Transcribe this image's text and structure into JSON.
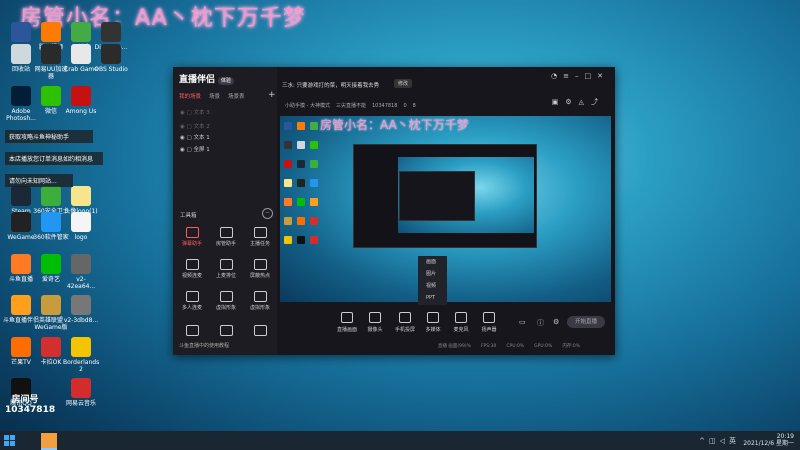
{
  "watermark": "房管小名：AA丶枕下万千梦",
  "watermark_preview": "房管小名：AA丶枕下万千梦",
  "desktop": {
    "icons": [
      {
        "label": "W",
        "color": "#2b579a"
      },
      {
        "label": "腾讯视频",
        "color": "#ff7a00"
      },
      {
        "label": "IYI迷你",
        "color": "#44aa44"
      },
      {
        "label": "DiceHelp...",
        "color": "#333"
      },
      {
        "label": "回收站",
        "color": "#cfd8dc"
      },
      {
        "label": "网易UU加速器",
        "color": "#2a2a2a"
      },
      {
        "label": "Crab Game",
        "color": "#e8e8e8"
      },
      {
        "label": "OBS Studio",
        "color": "#2b2b2b"
      },
      {
        "label": "Adobe Photosh...",
        "color": "#001e36"
      },
      {
        "label": "微信",
        "color": "#2dc100"
      },
      {
        "label": "Among Us",
        "color": "#c51111"
      },
      {
        "label": "Steam",
        "color": "#1b2838"
      },
      {
        "label": "360安全卫士",
        "color": "#3cae3c"
      },
      {
        "label": "头像logo(1)",
        "color": "#f6e58d"
      },
      {
        "label": "WeGame",
        "color": "#222"
      },
      {
        "label": "360软件管家",
        "color": "#2196f3"
      },
      {
        "label": "logo",
        "color": "#f5f5f5"
      },
      {
        "label": "斗鱼直播",
        "color": "#ff7a22"
      },
      {
        "label": "爱奇艺",
        "color": "#00be06"
      },
      {
        "label": "v2-42ea64...",
        "color": "#666"
      },
      {
        "label": "斗鱼直播伴侣",
        "color": "#ff9f1c"
      },
      {
        "label": "英雄联盟WeGame版",
        "color": "#c89b3c"
      },
      {
        "label": "v2-3dbd8...",
        "color": "#777"
      },
      {
        "label": "芒果TV",
        "color": "#ff6d00"
      },
      {
        "label": "卡拉OK",
        "color": "#d32f2f"
      },
      {
        "label": "Borderlands 2",
        "color": "#f2c500"
      },
      {
        "label": "腾讯QQ",
        "color": "#111"
      },
      {
        "label": "网易云音乐",
        "color": "#d42b2b"
      }
    ],
    "banner1": "获取攻略斗鱼神秘助手",
    "banner2": "本店播放您订单消息如约相消息",
    "banner3": "请勿向未知网站...",
    "room_label": "房间号",
    "room_id": "10347818"
  },
  "app": {
    "logo": "直播伴侣",
    "logo_badge": "体验",
    "scene_tabs": [
      {
        "label": "我的场景",
        "active": true
      },
      {
        "label": "场景",
        "active": false
      },
      {
        "label": "场景表",
        "active": false
      }
    ],
    "layers": [
      {
        "label": "文本 3",
        "dim": true
      },
      {
        "label": "文本 2",
        "dim": true
      },
      {
        "label": "文本 1",
        "dim": false
      },
      {
        "label": "全屏 1",
        "dim": false
      }
    ],
    "tools_title": "工具箱",
    "tools": [
      {
        "label": "弹幕助手",
        "red": true
      },
      {
        "label": "房管助手",
        "red": false
      },
      {
        "label": "主播任务",
        "red": false
      },
      {
        "label": "视频连麦",
        "red": false
      },
      {
        "label": "上麦排位",
        "red": false
      },
      {
        "label": "屏蔽热点",
        "red": false
      },
      {
        "label": "多人连麦",
        "red": false
      },
      {
        "label": "虚拟形象",
        "red": false
      },
      {
        "label": "虚拟形象",
        "red": false
      },
      {
        "label": "",
        "red": false
      },
      {
        "label": "",
        "red": false
      },
      {
        "label": "",
        "red": false
      }
    ],
    "side_bottom": "斗鱼直播中的使用教程",
    "info_text": "三水: 只要游戏打的菜，明天接着我去秀",
    "edit_label": "修改",
    "meta": [
      "小助手模 - 大神模式",
      "三尖直播不能",
      "10347818",
      "0",
      "8"
    ],
    "popup_items": [
      "画面",
      "图片",
      "视频",
      "PPT"
    ],
    "controls": [
      "直播画面",
      "摄像头",
      "手机投屏",
      "多媒体",
      "麦克风",
      "扬声器"
    ],
    "live_label": "开始直播",
    "status": [
      "直播 画面(99)%",
      "FPS:30",
      "CPU:0%",
      "GPU:0%",
      "内存:0%"
    ]
  },
  "taskbar": {
    "time": "20:19",
    "date": "2021/12/6 星期一"
  },
  "colors": {
    "accent": "#ff5a5a",
    "desktop_blue": "#166f9a"
  }
}
